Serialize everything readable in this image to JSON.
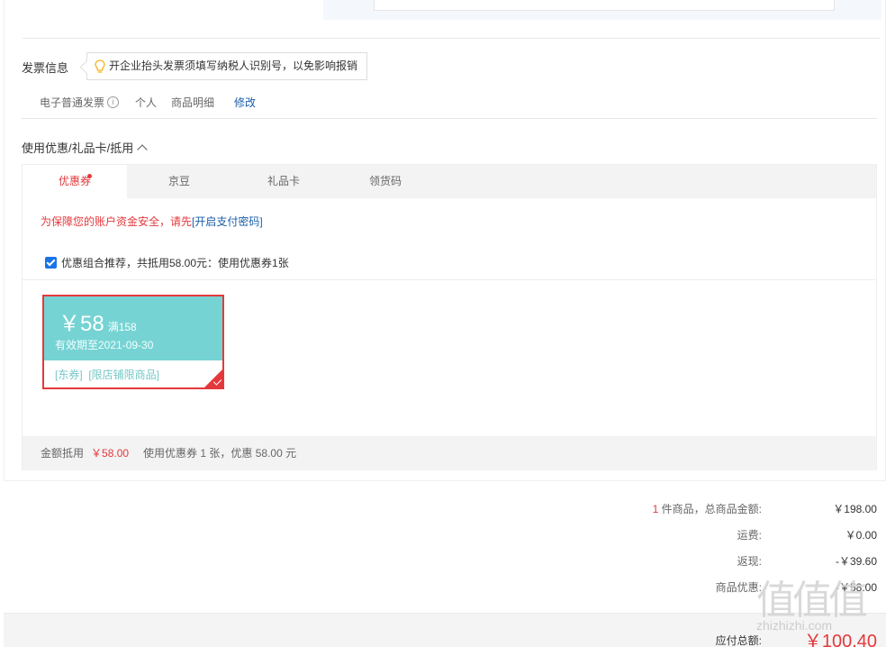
{
  "invoice": {
    "title": "发票信息",
    "tip": "开企业抬头发票须填写纳税人识别号，以免影响报销",
    "type": "电子普通发票",
    "info_icon": "i",
    "holder": "个人",
    "content": "商品明细",
    "edit_label": "修改"
  },
  "coupons": {
    "section_title": "使用优惠/礼品卡/抵用",
    "tabs": [
      {
        "label": "优惠券"
      },
      {
        "label": "京豆"
      },
      {
        "label": "礼品卡"
      },
      {
        "label": "领货码"
      }
    ],
    "warning_text": "为保障您的账户资金安全，请先",
    "warning_link": "[开启支付密码]",
    "combo_label": "优惠组合推荐，共抵用58.00元：使用优惠券1张",
    "coupon": {
      "amount": "￥58",
      "condition": "满158",
      "validity": "有效期至2021-09-30",
      "tag1": "[东券]",
      "tag2": "[限店铺限商品]"
    },
    "summary_label": "金额抵用",
    "summary_amount": "￥58.00",
    "summary_detail": "使用优惠券 1 张，优惠 58.00 元"
  },
  "totals": {
    "count": "1",
    "goods_label": "件商品，总商品金额:",
    "goods_value": "￥198.00",
    "freight_label": "运费:",
    "freight_value": "￥0.00",
    "cashback_label": "返现:",
    "cashback_value": "-￥39.60",
    "discount_label": "商品优惠:",
    "discount_value": "-￥58.00",
    "payable_label": "应付总额:",
    "payable_value": "￥100.40"
  },
  "watermark": {
    "logo": "值值值",
    "site": "zhizhizhi.com"
  },
  "colors": {
    "accent_red": "#e4393c",
    "link_blue": "#1a5ea8",
    "coupon_teal": "#76d3d3"
  }
}
